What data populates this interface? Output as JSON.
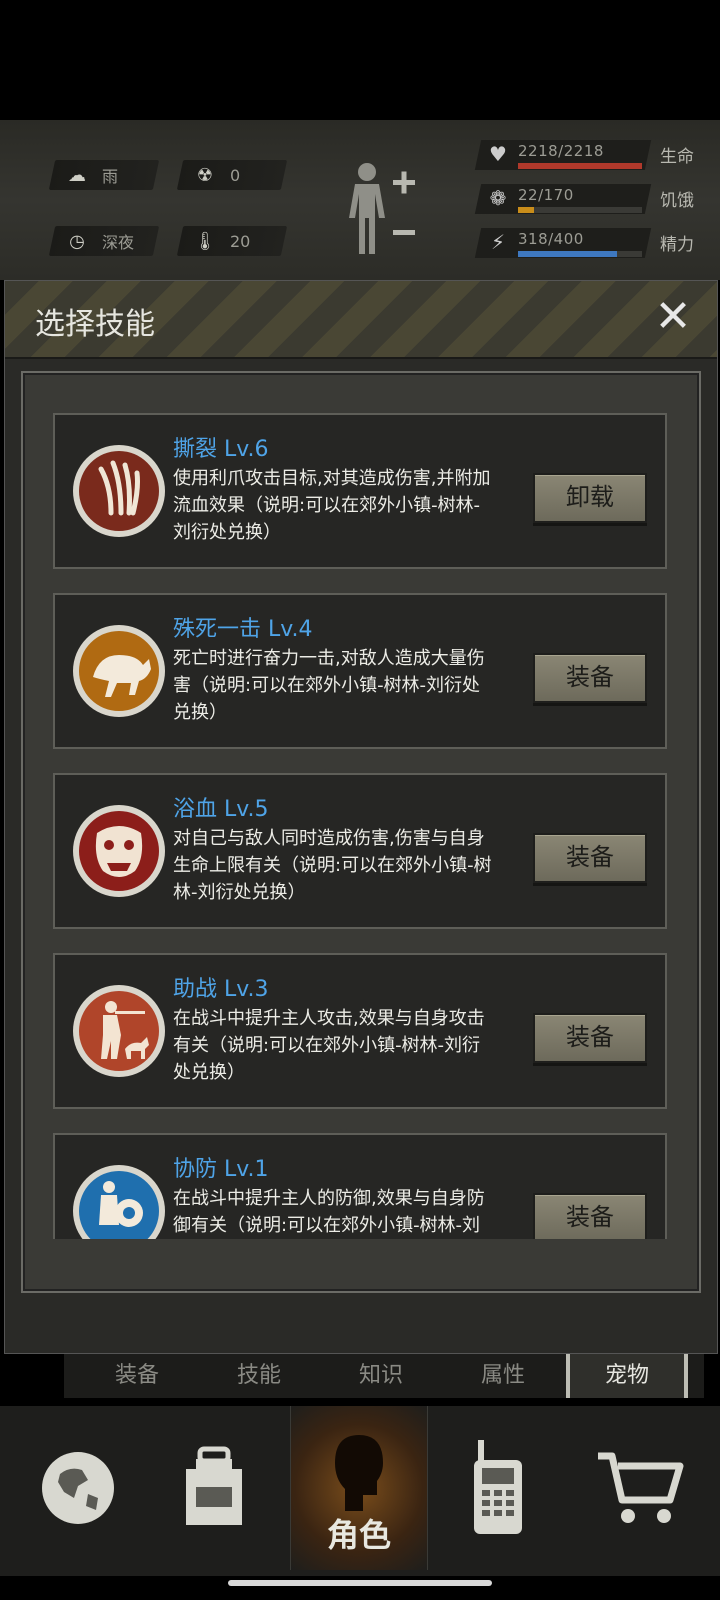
{
  "hud": {
    "weather": {
      "label": "雨",
      "icon": "rain-cloud-icon"
    },
    "radiation": {
      "value": "0",
      "icon": "radiation-icon"
    },
    "time_of_day": {
      "label": "深夜",
      "icon": "clock-icon"
    },
    "temperature": {
      "value": "20",
      "icon": "thermometer-icon"
    },
    "stats": [
      {
        "value": "2218/2218",
        "label": "生命",
        "fraction": 1.0,
        "color": "#b0392b",
        "icon": "heart-icon"
      },
      {
        "value": "22/170",
        "label": "饥饿",
        "fraction": 0.13,
        "color": "#c98d1a",
        "icon": "stomach-icon"
      },
      {
        "value": "318/400",
        "label": "精力",
        "fraction": 0.795,
        "color": "#3e78c0",
        "icon": "energy-icon"
      }
    ],
    "body_icon": "body-plus-minus-icon"
  },
  "panel": {
    "title": "选择技能",
    "close_icon": "close-icon"
  },
  "skills": [
    {
      "name": "撕裂 Lv.6",
      "desc": "使用利爪攻击目标,对其造成伤害,并附加流血效果（说明:可以在郊外小镇-树林-刘衍处兑换）",
      "button": "卸载",
      "icon": "claw-icon",
      "icon_bg": "#7a2a1c"
    },
    {
      "name": "殊死一击 Lv.4",
      "desc": "死亡时进行奋力一击,对敌人造成大量伤害（说明:可以在郊外小镇-树林-刘衍处兑换）",
      "button": "装备",
      "icon": "charging-bull-icon",
      "icon_bg": "#b06a12"
    },
    {
      "name": "浴血 Lv.5",
      "desc": "对自己与敌人同时造成伤害,伤害与自身生命上限有关（说明:可以在郊外小镇-树林-刘衍处兑换）",
      "button": "装备",
      "icon": "beast-face-icon",
      "icon_bg": "#8c1e1a"
    },
    {
      "name": "助战 Lv.3",
      "desc": "在战斗中提升主人攻击,效果与自身攻击有关（说明:可以在郊外小镇-树林-刘衍处兑换）",
      "button": "装备",
      "icon": "hunter-dog-icon",
      "icon_bg": "#b0452a"
    },
    {
      "name": "协防 Lv.1",
      "desc": "在战斗中提升主人的防御,效果与自身防御有关（说明:可以在郊外小镇-树林-刘衍处兑换）",
      "button": "装备",
      "icon": "shield-warrior-icon",
      "icon_bg": "#1f6fae"
    }
  ],
  "tabs": [
    "装备",
    "技能",
    "知识",
    "属性",
    "宠物"
  ],
  "active_tab": "宠物",
  "nav": [
    {
      "icon": "globe-icon",
      "label": ""
    },
    {
      "icon": "backpack-icon",
      "label": ""
    },
    {
      "icon": "character-head-icon",
      "label": "角色"
    },
    {
      "icon": "walkie-talkie-icon",
      "label": ""
    },
    {
      "icon": "shopping-cart-icon",
      "label": ""
    }
  ]
}
